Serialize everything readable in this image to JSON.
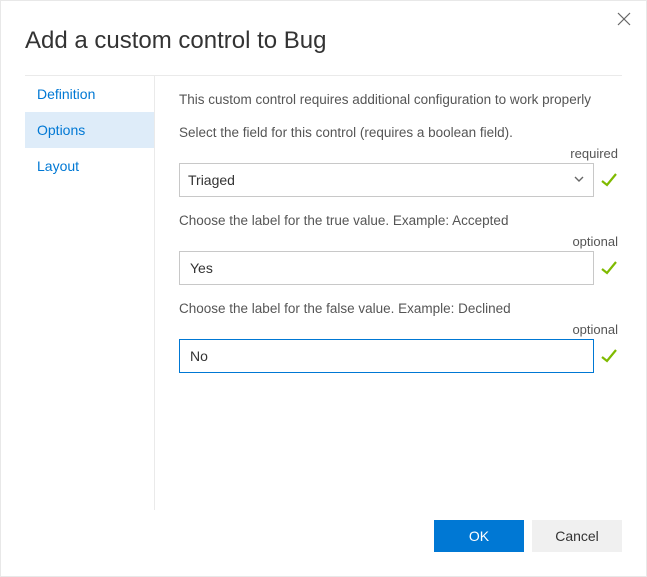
{
  "header": {
    "title": "Add a custom control to Bug"
  },
  "sidebar": {
    "items": [
      {
        "label": "Definition"
      },
      {
        "label": "Options"
      },
      {
        "label": "Layout"
      }
    ]
  },
  "main": {
    "intro": "This custom control requires additional configuration to work properly",
    "field_select_label": "Select the field for this control (requires a boolean field).",
    "field_select_indicator": "required",
    "field_select_value": "Triaged",
    "true_label": "Choose the label for the true value. Example: Accepted",
    "true_indicator": "optional",
    "true_value": "Yes",
    "false_label": "Choose the label for the false value. Example: Declined",
    "false_indicator": "optional",
    "false_value": "No"
  },
  "footer": {
    "ok": "OK",
    "cancel": "Cancel"
  }
}
